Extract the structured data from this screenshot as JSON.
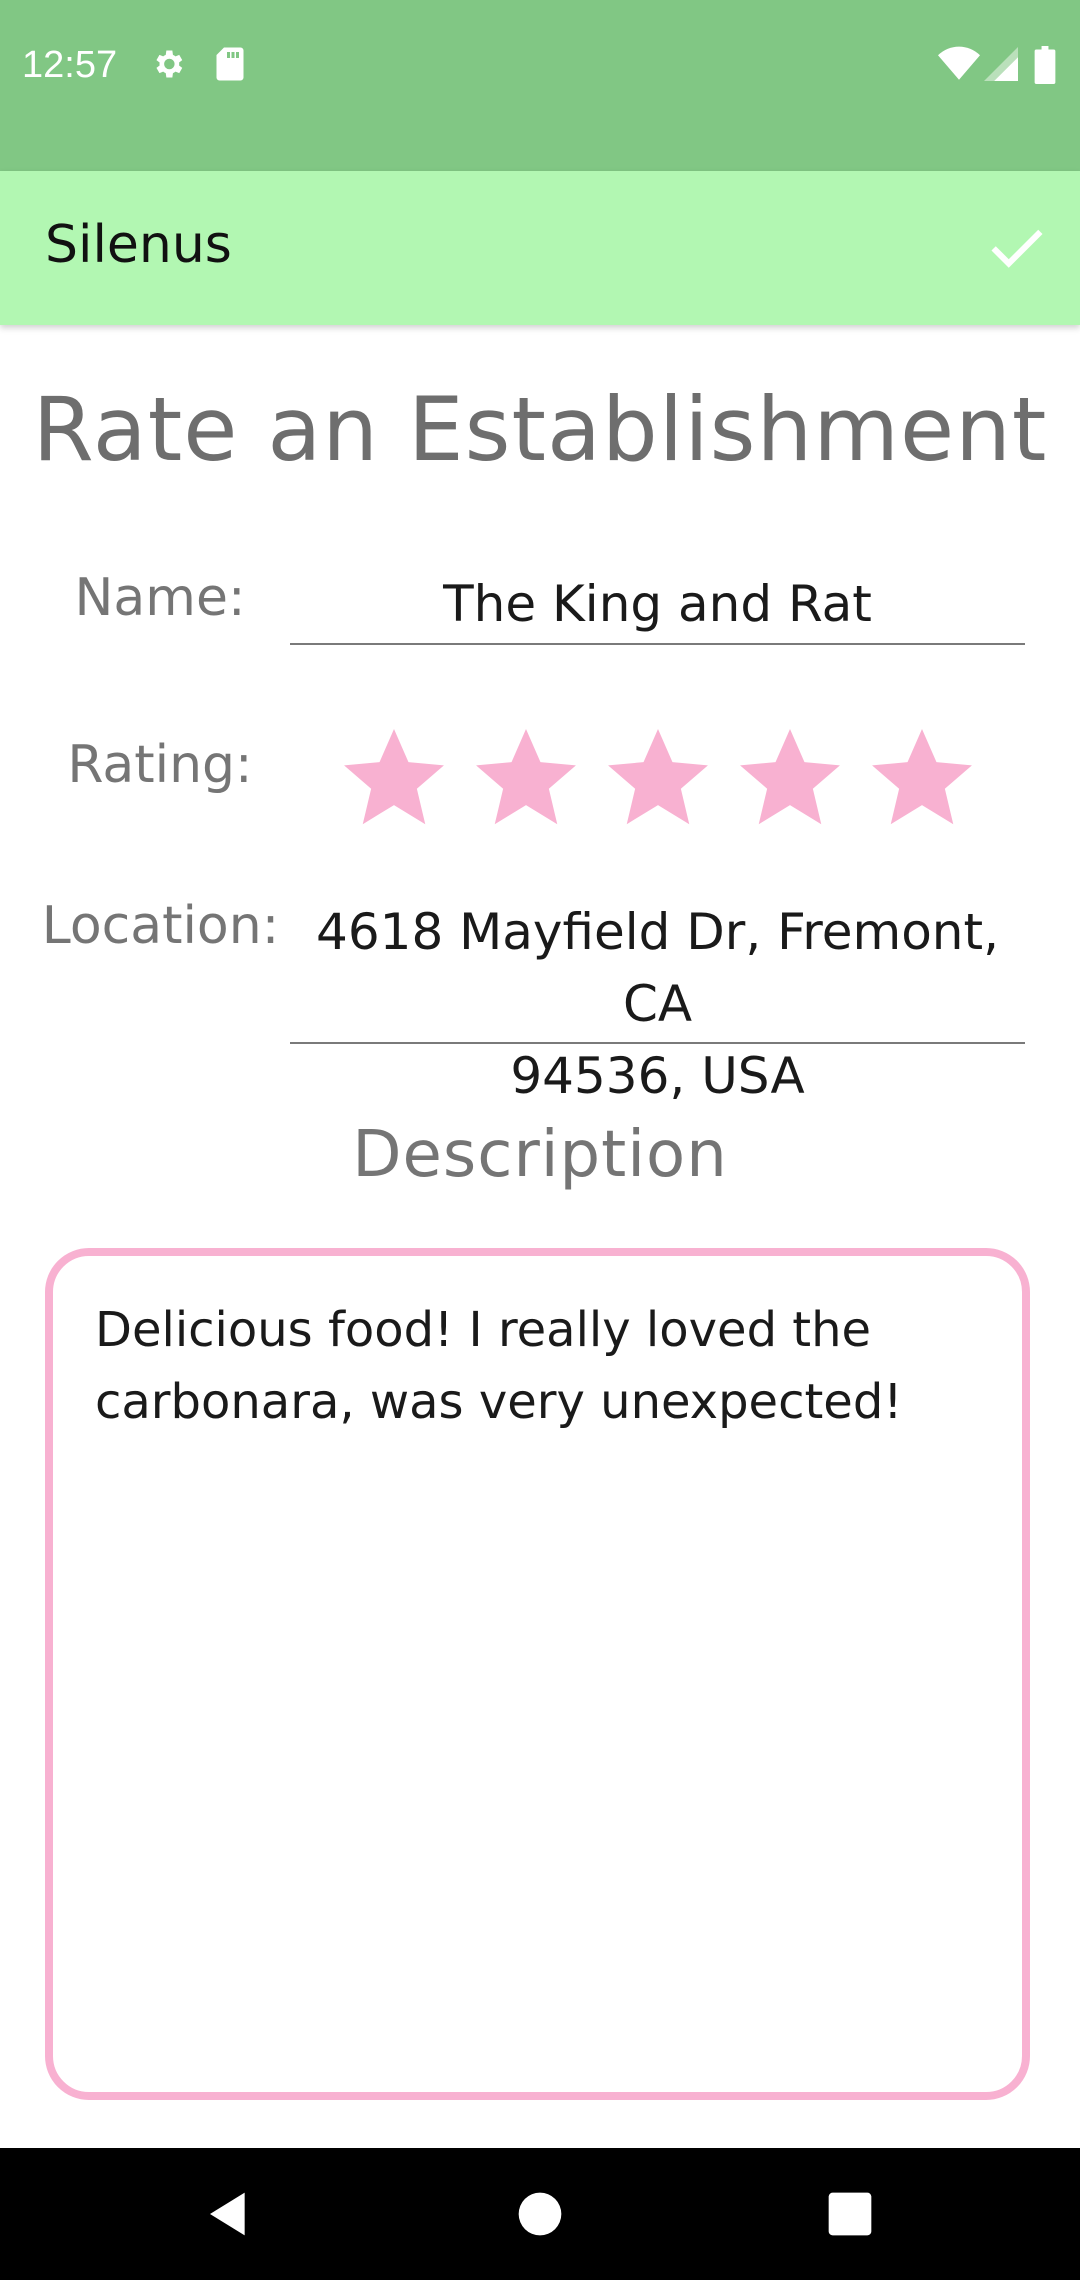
{
  "status_bar": {
    "time": "12:57",
    "icons": [
      "gear-icon",
      "sd-card-icon",
      "wifi-icon",
      "cellular-signal-icon",
      "battery-icon"
    ]
  },
  "app_bar": {
    "title": "Silenus",
    "confirm_icon": "check-icon"
  },
  "page": {
    "title": "Rate an Establishment"
  },
  "form": {
    "name_label": "Name:",
    "name_value": "The King and Rat",
    "rating_label": "Rating:",
    "rating": 5,
    "rating_max": 5,
    "location_label": "Location:",
    "location_line1": "4618 Mayfield Dr, Fremont, CA",
    "location_line2": "94536, USA",
    "description_heading": "Description",
    "description_line1": "Delicious food! I really loved the",
    "description_line2": "carbonara, was very unexpected!"
  },
  "nav_bar": {
    "icons": [
      "back-icon",
      "home-icon",
      "recents-icon"
    ]
  },
  "colors": {
    "status_bar": "#81c784",
    "app_bar": "#b2f7b2",
    "accent_pink": "#f8b1d1",
    "label_gray": "#757575"
  }
}
